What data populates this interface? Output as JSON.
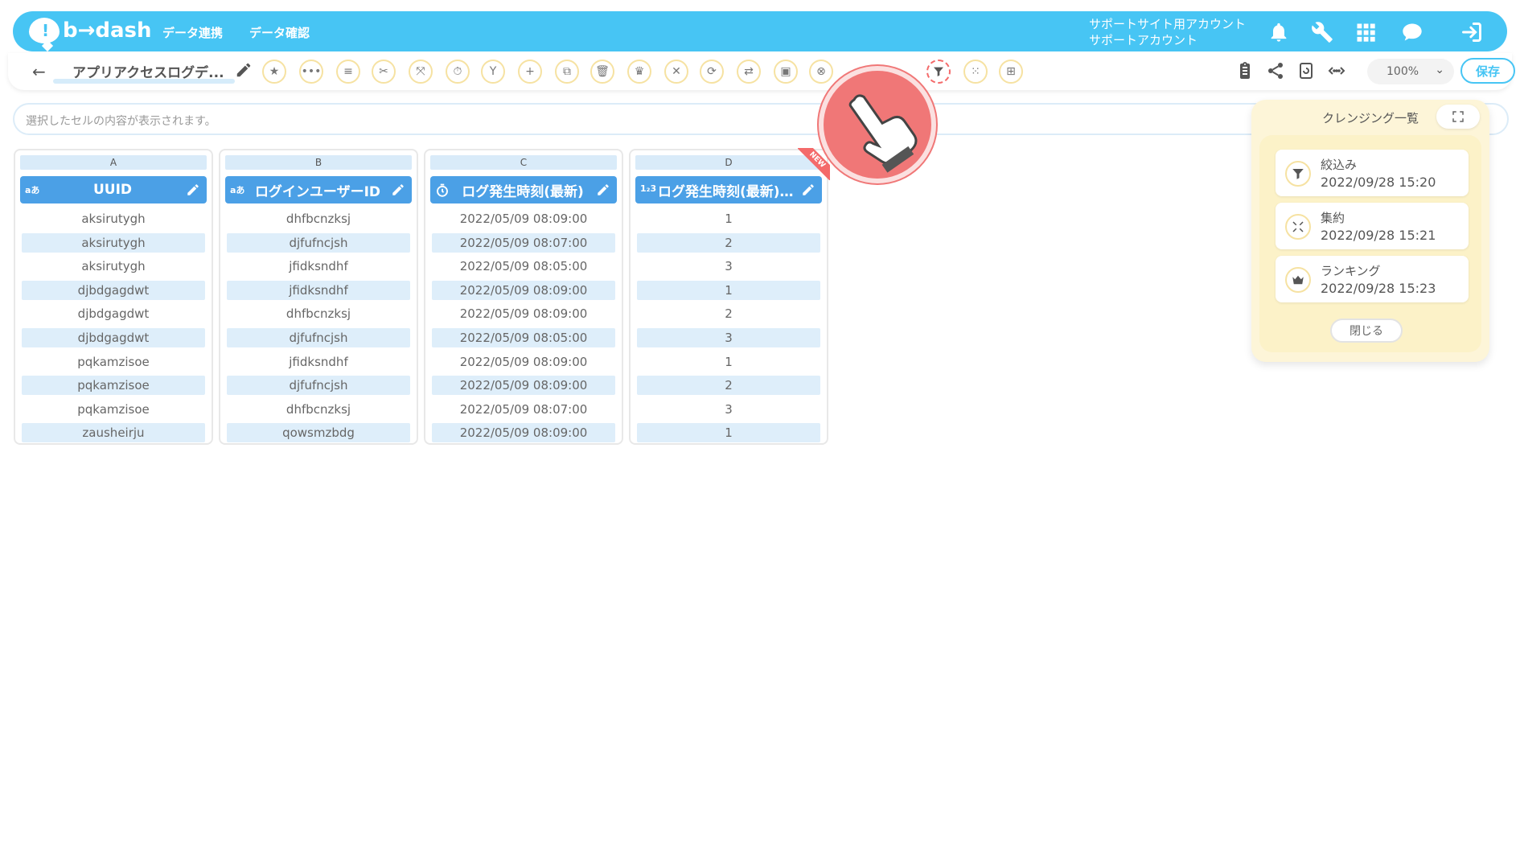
{
  "header": {
    "brand": "b→dash",
    "nav": [
      "データ連携",
      "データ確認"
    ],
    "account_line1": "サポートサイト用アカウント",
    "account_line2": "サポートアカウント",
    "icons": [
      "bell-icon",
      "wrench-icon",
      "apps-grid-icon",
      "chat-icon",
      "logout-icon"
    ]
  },
  "toolbar": {
    "title": "アプリアクセスログデ...",
    "zoom": "100%",
    "save_label": "保存"
  },
  "cellbar": {
    "placeholder": "選択したセルの内容が表示されます。"
  },
  "table": {
    "columns": [
      {
        "letter": "A",
        "type": "aあ",
        "name": "UUID",
        "cells": [
          "aksirutygh",
          "aksirutygh",
          "aksirutygh",
          "djbdgagdwt",
          "djbdgagdwt",
          "djbdgagdwt",
          "pqkamzisoe",
          "pqkamzisoe",
          "pqkamzisoe",
          "zausheirju"
        ]
      },
      {
        "letter": "B",
        "type": "aあ",
        "name": "ログインユーザーID",
        "cells": [
          "dhfbcnzksj",
          "djfufncjsh",
          "jfidksndhf",
          "jfidksndhf",
          "dhfbcnzksj",
          "djfufncjsh",
          "jfidksndhf",
          "djfufncjsh",
          "dhfbcnzksj",
          "qowsmzbdg"
        ]
      },
      {
        "letter": "C",
        "type": "clock",
        "name": "ログ発生時刻(最新)",
        "cells": [
          "2022/05/09 08:09:00",
          "2022/05/09 08:07:00",
          "2022/05/09 08:05:00",
          "2022/05/09 08:09:00",
          "2022/05/09 08:09:00",
          "2022/05/09 08:05:00",
          "2022/05/09 08:09:00",
          "2022/05/09 08:09:00",
          "2022/05/09 08:07:00",
          "2022/05/09 08:09:00"
        ]
      },
      {
        "letter": "D",
        "type": "1₂3",
        "name": "ログ発生時刻(最新)(…",
        "cells": [
          "1",
          "2",
          "3",
          "1",
          "2",
          "3",
          "1",
          "2",
          "3",
          "1"
        ]
      }
    ],
    "new_badge": "NEW"
  },
  "panel": {
    "title": "クレンジング一覧",
    "items": [
      {
        "name": "絞込み",
        "time": "2022/09/28 15:20",
        "icon": "filter-icon"
      },
      {
        "name": "集約",
        "time": "2022/09/28 15:21",
        "icon": "aggregate-icon"
      },
      {
        "name": "ランキング",
        "time": "2022/09/28 15:23",
        "icon": "crown-icon"
      }
    ],
    "close_label": "閉じる"
  }
}
